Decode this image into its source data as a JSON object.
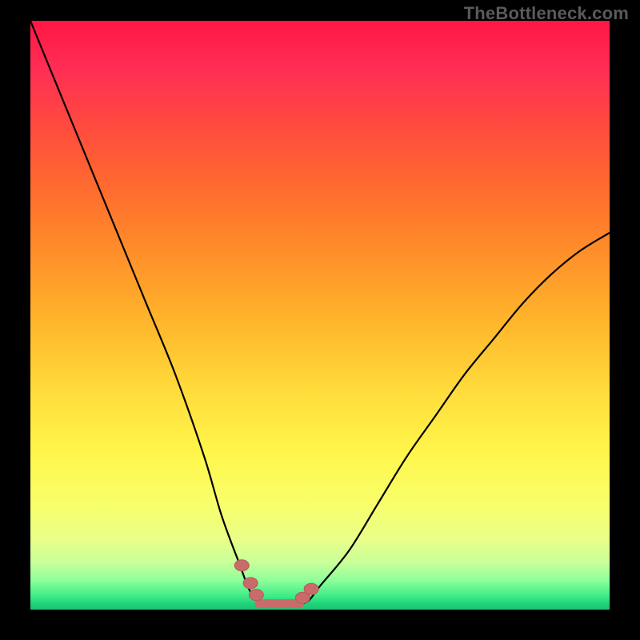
{
  "watermark": {
    "text": "TheBottleneck.com"
  },
  "colors": {
    "background": "#000000",
    "curve": "#000000",
    "marker": "#c96b6b",
    "marker_stroke": "#b65a5a"
  },
  "chart_data": {
    "type": "line",
    "title": "",
    "xlabel": "",
    "ylabel": "",
    "xlim": [
      0,
      100
    ],
    "ylim": [
      0,
      100
    ],
    "annotations": [
      "TheBottleneck.com"
    ],
    "note": "No axes, ticks, or numeric labels are visible. The curve is a V-shaped profile reaching the floor near x≈38–48. Values below are visual estimates of the curve height as percent of plot height, read against the gradient background.",
    "series": [
      {
        "name": "bottleneck-curve",
        "x": [
          0,
          5,
          10,
          15,
          20,
          25,
          30,
          33,
          36,
          38,
          40,
          42,
          44,
          46,
          48,
          50,
          55,
          60,
          65,
          70,
          75,
          80,
          85,
          90,
          95,
          100
        ],
        "y": [
          100,
          88,
          76,
          64,
          52,
          40,
          26,
          16,
          8,
          3,
          1,
          0.5,
          0.5,
          0.8,
          1.5,
          4,
          10,
          18,
          26,
          33,
          40,
          46,
          52,
          57,
          61,
          64
        ]
      }
    ],
    "markers": {
      "name": "valley-markers",
      "note": "Small pink rounded markers near the valley bottom; approximate positions in percent coordinates.",
      "points": [
        {
          "x": 36.5,
          "y": 7.5
        },
        {
          "x": 38.0,
          "y": 4.5
        },
        {
          "x": 39.0,
          "y": 2.5
        },
        {
          "x": 47.0,
          "y": 2.0
        },
        {
          "x": 48.5,
          "y": 3.5
        }
      ],
      "floor_segment": {
        "x_start": 39.5,
        "x_end": 46.5,
        "y": 1.0
      }
    }
  }
}
